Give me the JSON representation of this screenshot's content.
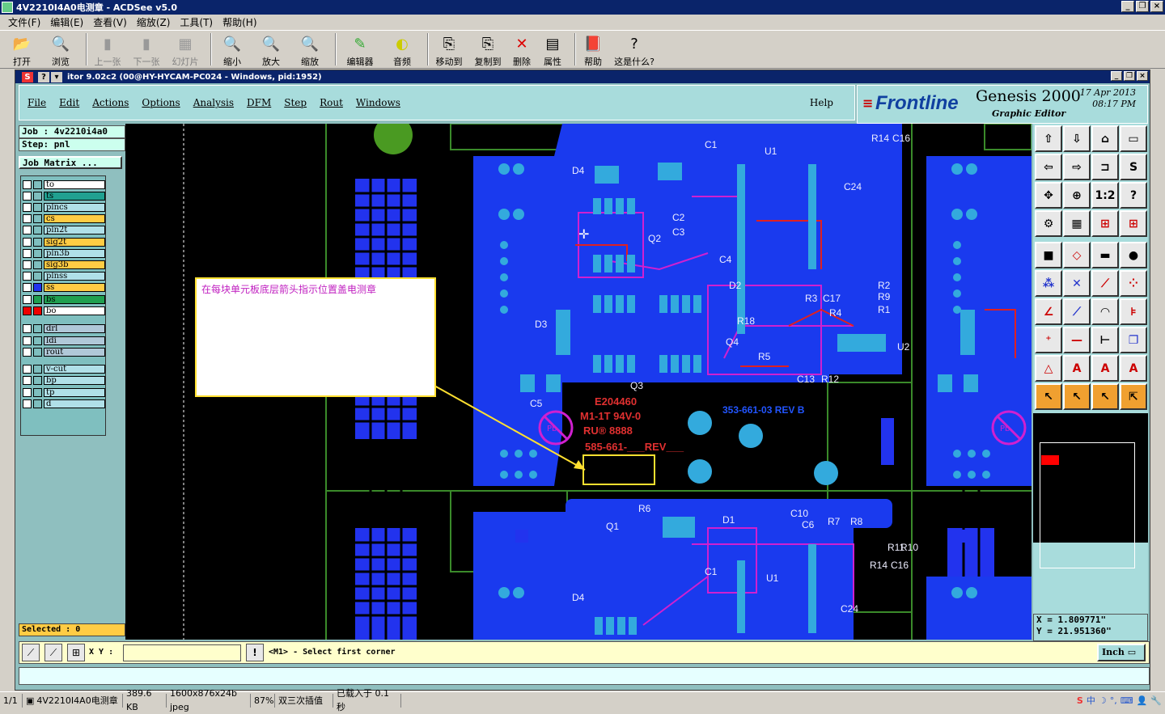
{
  "window": {
    "title": "4V2210I4A0电测章 - ACDSee v5.0"
  },
  "menu": [
    "文件(F)",
    "编辑(E)",
    "查看(V)",
    "缩放(Z)",
    "工具(T)",
    "帮助(H)"
  ],
  "toolbar": [
    {
      "label": "打开",
      "icon": "open-folder-icon",
      "disabled": false
    },
    {
      "label": "浏览",
      "icon": "browse-icon",
      "disabled": false
    },
    {
      "label": "上一张",
      "icon": "prev-image-icon",
      "disabled": true
    },
    {
      "label": "下一张",
      "icon": "next-image-icon",
      "disabled": true
    },
    {
      "label": "幻灯片",
      "icon": "slideshow-icon",
      "disabled": true
    },
    {
      "label": "缩小",
      "icon": "zoom-out-icon",
      "disabled": false
    },
    {
      "label": "放大",
      "icon": "zoom-in-icon",
      "disabled": false
    },
    {
      "label": "缩放",
      "icon": "zoom-icon",
      "disabled": false
    },
    {
      "label": "编辑器",
      "icon": "editor-icon",
      "disabled": false
    },
    {
      "label": "音频",
      "icon": "audio-icon",
      "disabled": false
    },
    {
      "label": "移动到",
      "icon": "move-to-icon",
      "disabled": false
    },
    {
      "label": "复制到",
      "icon": "copy-to-icon",
      "disabled": false
    },
    {
      "label": "删除",
      "icon": "delete-icon",
      "disabled": false
    },
    {
      "label": "属性",
      "icon": "properties-icon",
      "disabled": false
    },
    {
      "label": "帮助",
      "icon": "help-book-icon",
      "disabled": false
    },
    {
      "label": "这是什么?",
      "icon": "whats-this-icon",
      "disabled": false
    }
  ],
  "inner_title": "itor 9.02c2 (00@HY-HYCAM-PC024 - Windows, pid:1952)",
  "genesis_menu": [
    "File",
    "Edit",
    "Actions",
    "Options",
    "Analysis",
    "DFM",
    "Step",
    "Rout",
    "Windows"
  ],
  "genesis_help": "Help",
  "logo": {
    "brand": "Frontline",
    "product": "Genesis 2000",
    "subtitle": "Graphic Editor",
    "date": "17 Apr 2013",
    "time": "08:17 PM"
  },
  "job": {
    "job_line": "Job : 4v2210i4a0",
    "step_line": "Step: pnl",
    "matrix_button": "Job Matrix ..."
  },
  "layers": [
    {
      "name": "to",
      "color": "#ffffff"
    },
    {
      "name": "ts",
      "color": "#20a090"
    },
    {
      "name": "plncs",
      "color": "#b0e0e8"
    },
    {
      "name": "cs",
      "color": "#ffcc44"
    },
    {
      "name": "pln2t",
      "color": "#b0e0e8"
    },
    {
      "name": "sig2t",
      "color": "#ffcc44"
    },
    {
      "name": "pln3b",
      "color": "#b0e0e8"
    },
    {
      "name": "sig3b",
      "color": "#ffcc44"
    },
    {
      "name": "plnss",
      "color": "#b0e0e8"
    },
    {
      "name": "ss",
      "color": "#ffcc44"
    },
    {
      "name": "bs",
      "color": "#20a050"
    },
    {
      "name": "bo",
      "color": "#ffffff"
    },
    {
      "name": "drl",
      "color": "#b0c8d8"
    },
    {
      "name": "ldi",
      "color": "#b0c8d8"
    },
    {
      "name": "rout",
      "color": "#b0c8d8"
    },
    {
      "name": "v-cut",
      "color": "#b0e0e8"
    },
    {
      "name": "bp",
      "color": "#b0e0e8"
    },
    {
      "name": "tp",
      "color": "#b0e0e8"
    },
    {
      "name": "d",
      "color": "#b0e0e8"
    }
  ],
  "selected": "Selected : 0",
  "annotation": "在每块单元板底层箭头指示位置盖电测章",
  "pcb_text": {
    "mark1": "E204460",
    "mark2": "M1-1T 94V-0",
    "mark3": "RU® 8888",
    "mark4": "585-661-___REV___",
    "mark5": "353-661-03 REV B",
    "refs_top": [
      "D4",
      "C1",
      "U1",
      "R14",
      "C16",
      "C24",
      "C2",
      "C3",
      "Q2",
      "C4",
      "D2",
      "R2",
      "R9",
      "R3",
      "C17",
      "R1",
      "R4",
      "R18",
      "D3",
      "Q4",
      "R5",
      "U2",
      "C13",
      "R12",
      "Q3",
      "C5"
    ],
    "refs_bottom": [
      "R6",
      "D1",
      "C10",
      "C6",
      "R7",
      "R8",
      "Q1",
      "R10",
      "R11",
      "C1",
      "R14",
      "C16",
      "U1",
      "D4",
      "C24"
    ]
  },
  "coords": {
    "x": "X = 1.809771\"",
    "y": "Y = 21.951360\""
  },
  "cmd": {
    "label": "X Y :",
    "value": "",
    "prompt": "<M1> - Select first corner",
    "units": "Inch"
  },
  "statusbar": {
    "index": "1/1",
    "file": "4V2210I4A0电测章",
    "size": "389.6 KB",
    "dims": "1600x876x24b jpeg",
    "zoom": "87%",
    "interp": "双三次插值",
    "loaded": "已载入于 0.1 秒"
  },
  "ime": {
    "lang": "中"
  }
}
